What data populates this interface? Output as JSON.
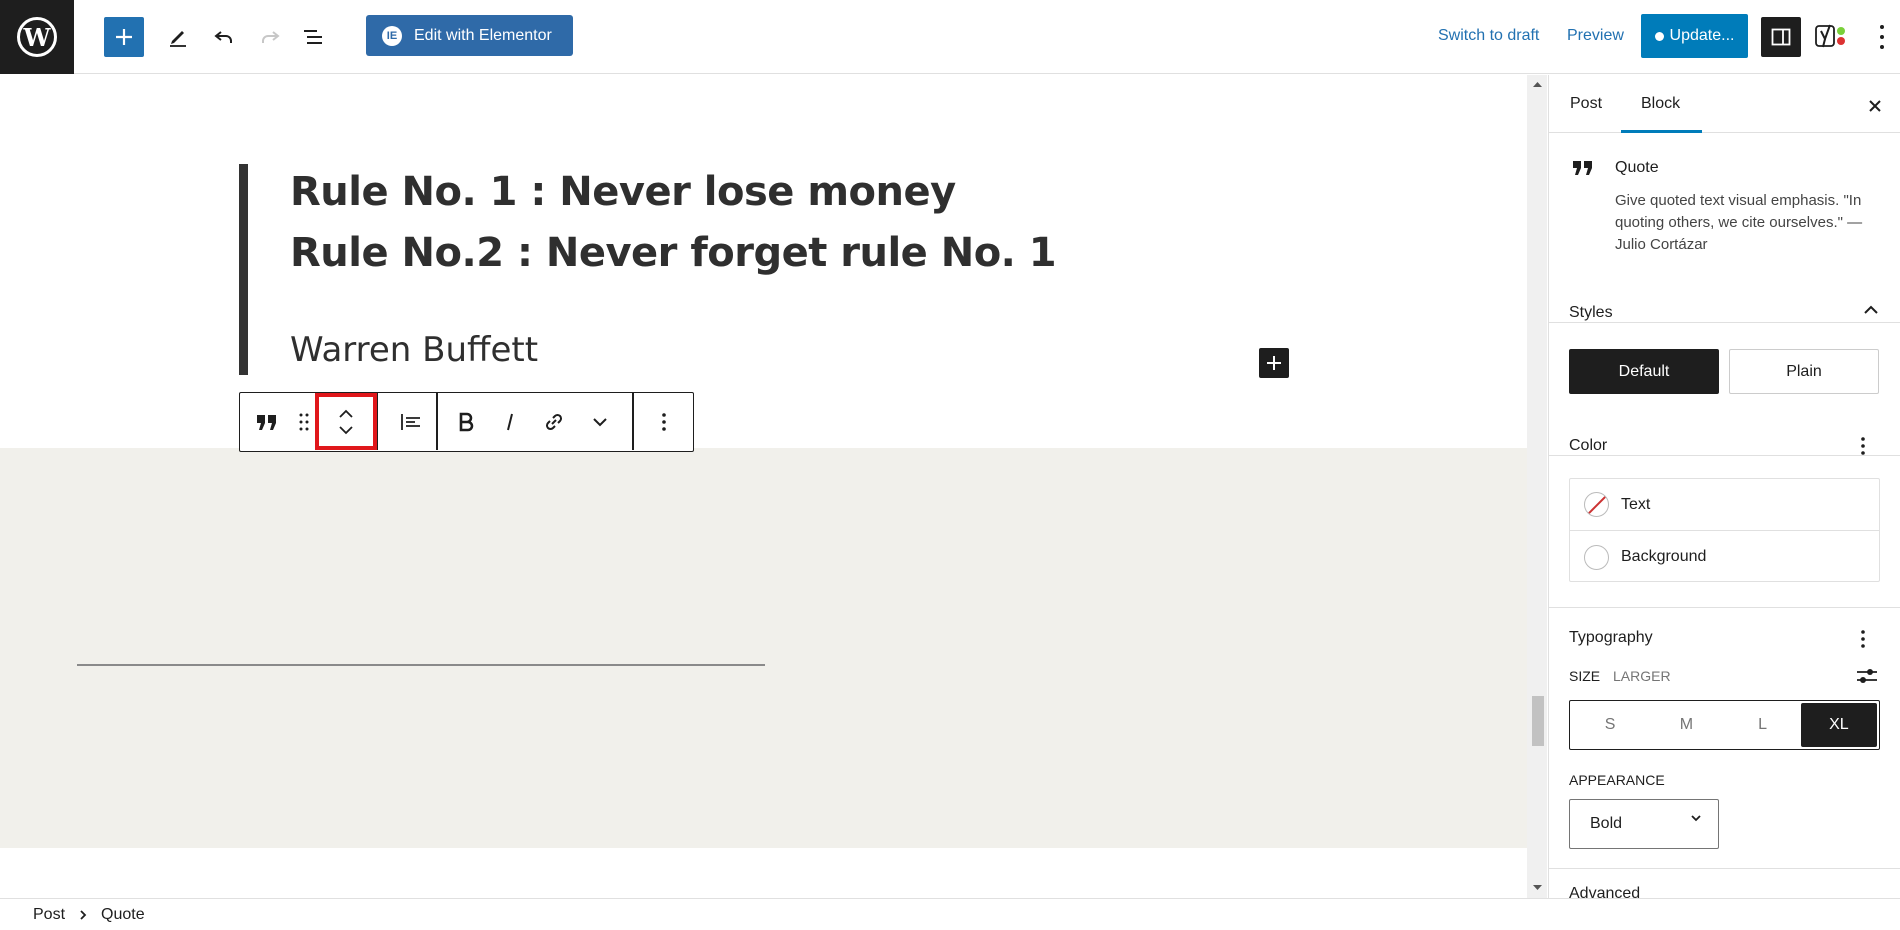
{
  "topbar": {
    "logo_letter": "W",
    "elementor_label": "Edit with Elementor",
    "elementor_badge": "IE",
    "switch_to_draft": "Switch to draft",
    "preview": "Preview",
    "update_label": "Update...",
    "accent_color": "#007cba"
  },
  "editor": {
    "quote_lines": [
      "Rule No. 1 : Never lose money",
      "Rule No.2 : Never forget rule No. 1"
    ],
    "citation": "Warren Buffett",
    "section_bg": "#f1f0eb"
  },
  "sidebar": {
    "tabs": [
      "Post",
      "Block"
    ],
    "active_tab": "Block",
    "block_card": {
      "title": "Quote",
      "description": "Give quoted text visual emphasis. \"In quoting others, we cite ourselves.\" — Julio Cortázar"
    },
    "styles": {
      "title": "Styles",
      "options": [
        "Default",
        "Plain"
      ],
      "active": "Default"
    },
    "color": {
      "title": "Color",
      "items": [
        "Text",
        "Background"
      ]
    },
    "typography": {
      "title": "Typography",
      "size_label": "SIZE",
      "size_value": "LARGER",
      "sizes": [
        "S",
        "M",
        "L",
        "XL"
      ],
      "active_size": "XL",
      "appearance_label": "APPEARANCE",
      "appearance_value": "Bold"
    },
    "next_section_partial": "Advanced"
  },
  "footer": {
    "breadcrumb": [
      "Post",
      "Quote"
    ]
  },
  "highlight_color": "#e0171b"
}
